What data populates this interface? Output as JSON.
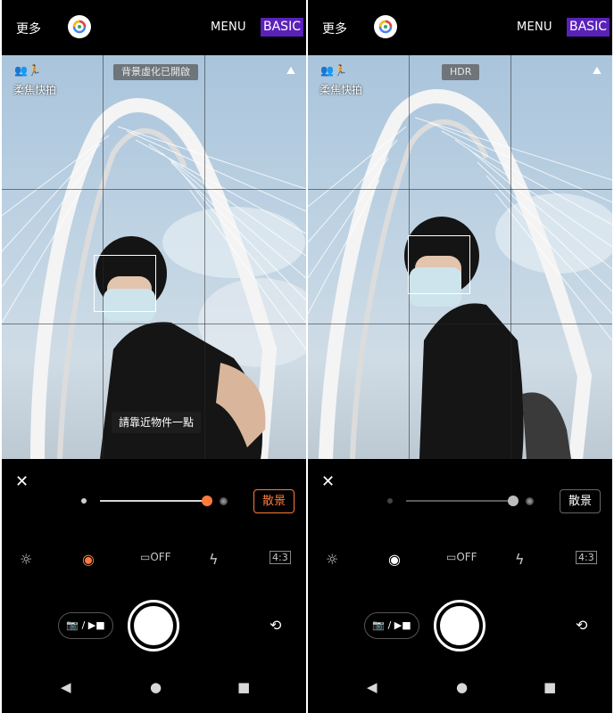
{
  "screens": [
    {
      "top": {
        "more_label": "更多",
        "menu_label": "MENU",
        "mode_badge": "BASIC"
      },
      "viewfinder": {
        "mode_icons": "👥🏃",
        "mode_label": "柔焦快拍",
        "status_chip": "背景虛化已開啟",
        "exposure_icon": "⛰",
        "hint": "請靠近物件一點"
      },
      "controls": {
        "close": "✕",
        "bokeh_label": "散景",
        "bokeh_active": true,
        "blur_level": 1.0,
        "accent_color": "#ff7a3d"
      },
      "quick_icons": [
        "☼",
        "◉",
        "▭OFF",
        "ϟ",
        "4:3"
      ],
      "switch_label": "📷 / ▶■",
      "flip_icon": "⟲",
      "nav": [
        "◀",
        "●",
        "■"
      ]
    },
    {
      "top": {
        "more_label": "更多",
        "menu_label": "MENU",
        "mode_badge": "BASIC"
      },
      "viewfinder": {
        "mode_icons": "👥🏃",
        "mode_label": "柔焦快拍",
        "status_chip": "HDR",
        "exposure_icon": "⛰"
      },
      "controls": {
        "close": "✕",
        "bokeh_label": "散景",
        "bokeh_active": false,
        "blur_level": 1.0,
        "accent_color": "#ffffff"
      },
      "quick_icons": [
        "☼",
        "◉",
        "▭OFF",
        "ϟ",
        "4:3"
      ],
      "switch_label": "📷 / ▶■",
      "flip_icon": "⟲",
      "nav": [
        "◀",
        "●",
        "■"
      ]
    }
  ]
}
